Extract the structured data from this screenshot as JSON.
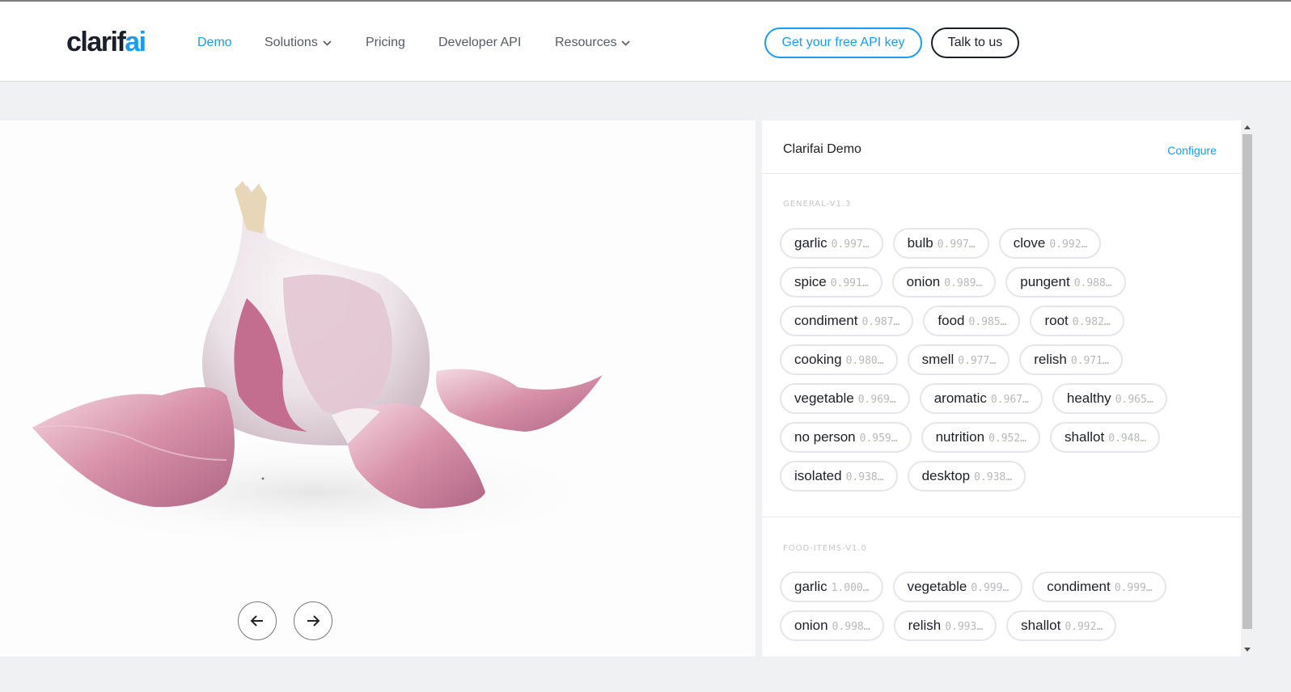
{
  "header": {
    "logo": {
      "part1": "clarif",
      "part2": "ai"
    },
    "nav": [
      {
        "label": "Demo",
        "active": true,
        "has_dropdown": false
      },
      {
        "label": "Solutions",
        "active": false,
        "has_dropdown": true
      },
      {
        "label": "Pricing",
        "active": false,
        "has_dropdown": false
      },
      {
        "label": "Developer API",
        "active": false,
        "has_dropdown": false
      },
      {
        "label": "Resources",
        "active": false,
        "has_dropdown": true
      }
    ],
    "api_key_button": "Get your free API key",
    "talk_button": "Talk to us"
  },
  "viewer": {
    "prev_icon": "arrow-left-icon",
    "next_icon": "arrow-right-icon"
  },
  "panel": {
    "title": "Clarifai Demo",
    "configure_label": "Configure",
    "models": [
      {
        "name": "GENERAL-V1.3",
        "concepts": [
          {
            "name": "garlic",
            "value": "0.997…"
          },
          {
            "name": "bulb",
            "value": "0.997…"
          },
          {
            "name": "clove",
            "value": "0.992…"
          },
          {
            "name": "spice",
            "value": "0.991…"
          },
          {
            "name": "onion",
            "value": "0.989…"
          },
          {
            "name": "pungent",
            "value": "0.988…"
          },
          {
            "name": "condiment",
            "value": "0.987…"
          },
          {
            "name": "food",
            "value": "0.985…"
          },
          {
            "name": "root",
            "value": "0.982…"
          },
          {
            "name": "cooking",
            "value": "0.980…"
          },
          {
            "name": "smell",
            "value": "0.977…"
          },
          {
            "name": "relish",
            "value": "0.971…"
          },
          {
            "name": "vegetable",
            "value": "0.969…"
          },
          {
            "name": "aromatic",
            "value": "0.967…"
          },
          {
            "name": "healthy",
            "value": "0.965…"
          },
          {
            "name": "no person",
            "value": "0.959…"
          },
          {
            "name": "nutrition",
            "value": "0.952…"
          },
          {
            "name": "shallot",
            "value": "0.948…"
          },
          {
            "name": "isolated",
            "value": "0.938…"
          },
          {
            "name": "desktop",
            "value": "0.938…"
          }
        ]
      },
      {
        "name": "FOOD-ITEMS-V1.0",
        "concepts": [
          {
            "name": "garlic",
            "value": "1.000…"
          },
          {
            "name": "vegetable",
            "value": "0.999…"
          },
          {
            "name": "condiment",
            "value": "0.999…"
          },
          {
            "name": "onion",
            "value": "0.998…"
          },
          {
            "name": "relish",
            "value": "0.993…"
          },
          {
            "name": "shallot",
            "value": "0.992…"
          }
        ]
      }
    ]
  },
  "colors": {
    "accent": "#1a9cf2",
    "dark": "#1b1f2a",
    "garlic_skin": "#c77a9a"
  }
}
